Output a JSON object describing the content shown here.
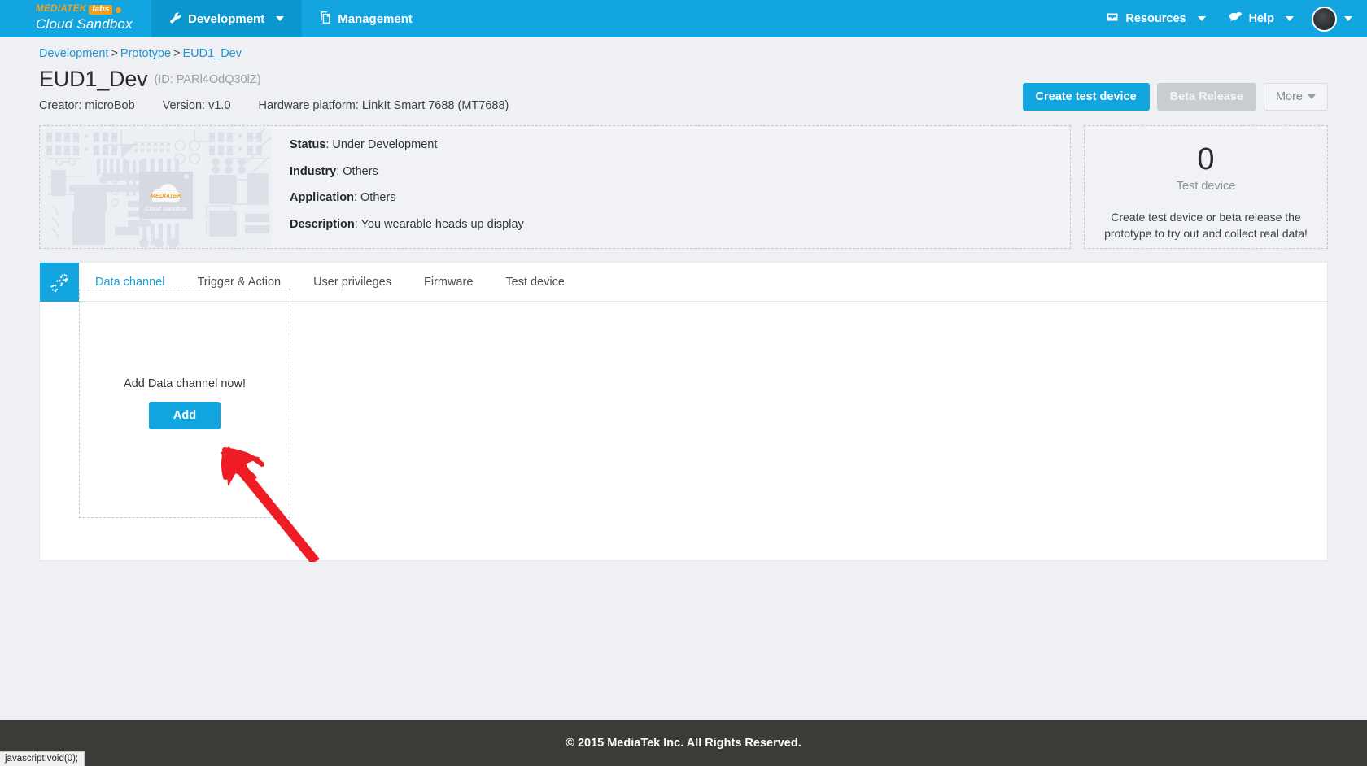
{
  "navbar": {
    "brand": {
      "mediatek": "MEDIATEK",
      "labs": "labs",
      "product": "Cloud Sandbox"
    },
    "left_items": [
      {
        "label": "Development",
        "icon": "wrench-icon",
        "active": true,
        "has_caret": true
      },
      {
        "label": "Management",
        "icon": "copy-icon",
        "active": false,
        "has_caret": false
      }
    ],
    "right_items": [
      {
        "label": "Resources",
        "icon": "inbox-icon",
        "has_caret": true
      },
      {
        "label": "Help",
        "icon": "chat-icon",
        "has_caret": true
      }
    ],
    "account_caret": "▾"
  },
  "breadcrumb": {
    "items": [
      "Development",
      "Prototype",
      "EUD1_Dev"
    ],
    "separator": ">"
  },
  "header": {
    "title": "EUD1_Dev",
    "id_text": "(ID: PARl4OdQ30lZ)",
    "meta": [
      {
        "label": "Creator:",
        "value": "microBob"
      },
      {
        "label": "Version:",
        "value": "v1.0"
      },
      {
        "label": "Hardware platform:",
        "value": "LinkIt Smart 7688 (MT7688)"
      }
    ],
    "actions": {
      "create_test_device": "Create test device",
      "beta_release": "Beta Release",
      "more": "More"
    }
  },
  "info_panel": {
    "thumbnail_alt": "circuit-board-cloud-sandbox-thumbnail",
    "thumbnail_logo_text": "MEDIATEK",
    "thumbnail_logo_sub": "Cloud Sandbox",
    "rows": [
      {
        "label": "Status",
        "value": "Under Development"
      },
      {
        "label": "Industry",
        "value": "Others"
      },
      {
        "label": "Application",
        "value": "Others"
      },
      {
        "label": "Description",
        "value": "You wearable heads up display"
      }
    ]
  },
  "device_panel": {
    "count": "0",
    "count_label": "Test device",
    "hint": "Create test device or beta release the prototype to try out and collect real data!"
  },
  "tabs": {
    "icon_name": "gears-icon",
    "items": [
      {
        "label": "Data channel",
        "active": true
      },
      {
        "label": "Trigger & Action",
        "active": false
      },
      {
        "label": "User privileges",
        "active": false
      },
      {
        "label": "Firmware",
        "active": false
      },
      {
        "label": "Test device",
        "active": false
      }
    ]
  },
  "empty_state": {
    "message": "Add Data channel now!",
    "add_button": "Add",
    "annotation": "red-hand-drawn-arrow"
  },
  "footer": {
    "copyright": "© 2015 MediaTek Inc. All Rights Reserved."
  },
  "statusbar": {
    "url": "javascript:void(0);"
  },
  "colors": {
    "brand_blue": "#12a5e0",
    "brand_orange": "#f0a020",
    "footer_dark": "#3b3b38",
    "annotation_red": "#ee1c25"
  }
}
